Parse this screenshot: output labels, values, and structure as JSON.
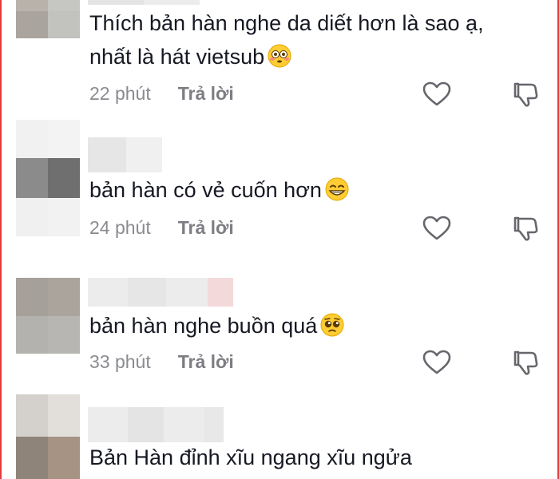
{
  "comments": [
    {
      "text": "Thích bản hàn nghe da diết hơn là sao ạ,\nnhất là hát vietsub",
      "emoji": "flushed-face",
      "time": "22 phút",
      "reply_label": "Trả lời"
    },
    {
      "text": "bản hàn có vẻ cuốn hơn",
      "emoji": "grinning-face",
      "time": "24 phút",
      "reply_label": "Trả lời"
    },
    {
      "text": "bản hàn nghe buồn quá",
      "emoji": "pleading-face",
      "time": "33 phút",
      "reply_label": "Trả lời"
    },
    {
      "text": "Bản Hàn đỉnh xĩu ngang xĩu ngửa",
      "emoji": "",
      "time": "",
      "reply_label": ""
    }
  ],
  "icons": {
    "like": "heart-outline-icon",
    "dislike": "thumbs-down-outline-icon"
  },
  "colors": {
    "text": "#161823",
    "meta": "#8a8b91",
    "border": "#e23a3a"
  }
}
